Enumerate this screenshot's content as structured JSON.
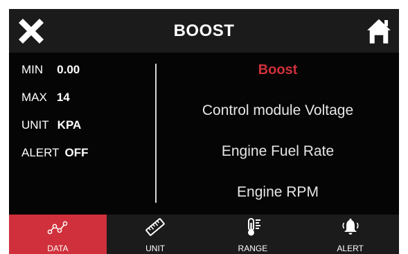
{
  "header": {
    "title": "BOOST",
    "close_icon": "close-icon",
    "home_icon": "home-icon"
  },
  "info": [
    {
      "label": "MIN",
      "value": "0.00"
    },
    {
      "label": "MAX",
      "value": "14"
    },
    {
      "label": "UNIT",
      "value": "KPA"
    },
    {
      "label": "ALERT",
      "value": "OFF"
    }
  ],
  "options": [
    {
      "label": "Boost",
      "selected": true
    },
    {
      "label": "Control module Voltage",
      "selected": false
    },
    {
      "label": "Engine Fuel Rate",
      "selected": false
    },
    {
      "label": "Engine RPM",
      "selected": false
    }
  ],
  "tabs": [
    {
      "label": "DATA",
      "icon": "line-graph-icon",
      "active": true
    },
    {
      "label": "UNIT",
      "icon": "ruler-icon",
      "active": false
    },
    {
      "label": "RANGE",
      "icon": "thermometer-icon",
      "active": false
    },
    {
      "label": "ALERT",
      "icon": "bell-icon",
      "active": false
    }
  ],
  "colors": {
    "accent": "#d0303b",
    "background": "#050505",
    "bar": "#1b1b1b",
    "text": "#ffffff"
  }
}
